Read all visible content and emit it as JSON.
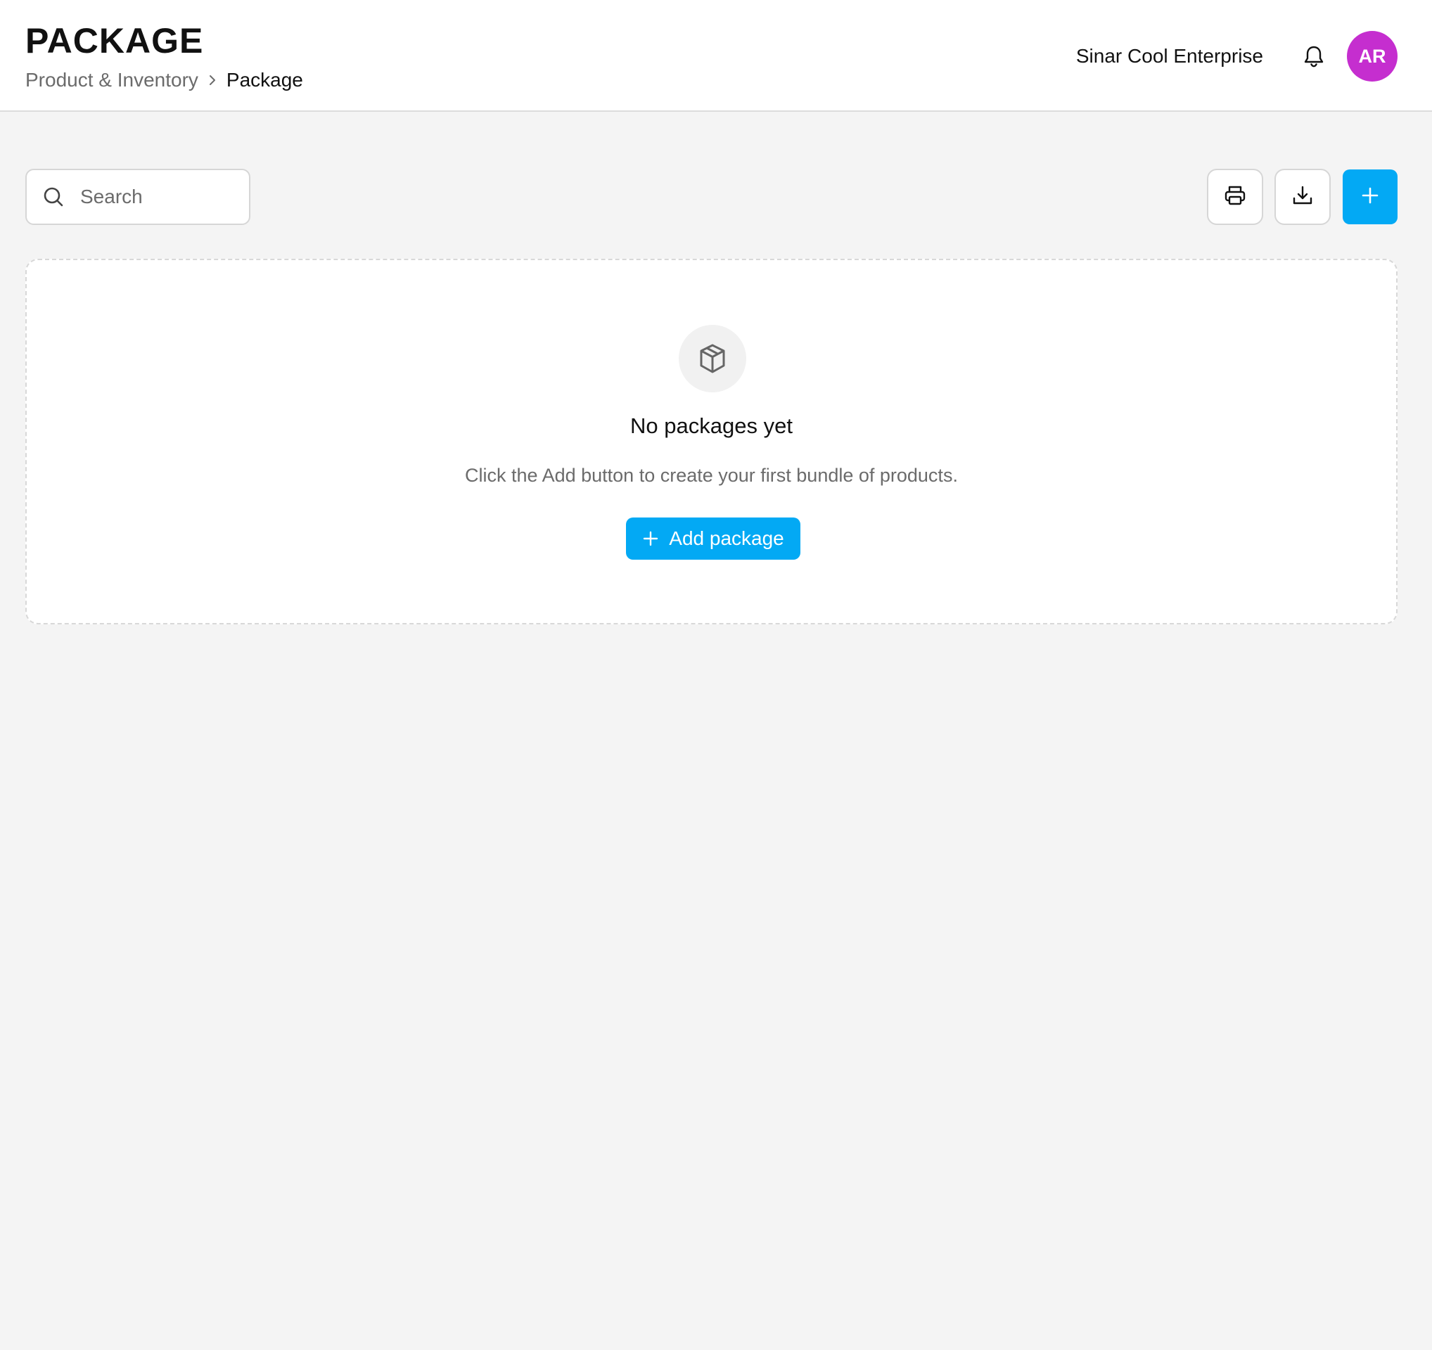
{
  "header": {
    "title": "PACKAGE",
    "breadcrumb": {
      "parent": "Product & Inventory",
      "separator_icon": "chevron-right-icon",
      "current": "Package"
    },
    "company_name": "Sinar Cool Enterprise",
    "notification_icon": "bell-icon",
    "avatar_initials": "AR",
    "avatar_color": "#c52ecf"
  },
  "toolbar": {
    "search": {
      "placeholder": "Search",
      "value": "",
      "icon": "search-icon"
    },
    "print_icon": "printer-icon",
    "download_icon": "download-icon",
    "add_icon": "plus-icon"
  },
  "empty_state": {
    "icon": "package-icon",
    "title": "No packages yet",
    "description": "Click the Add button to create your first bundle of products.",
    "button_label": "Add package"
  },
  "colors": {
    "accent": "#03a9f4",
    "background": "#f4f4f4",
    "text_muted": "#6b6b6b"
  }
}
